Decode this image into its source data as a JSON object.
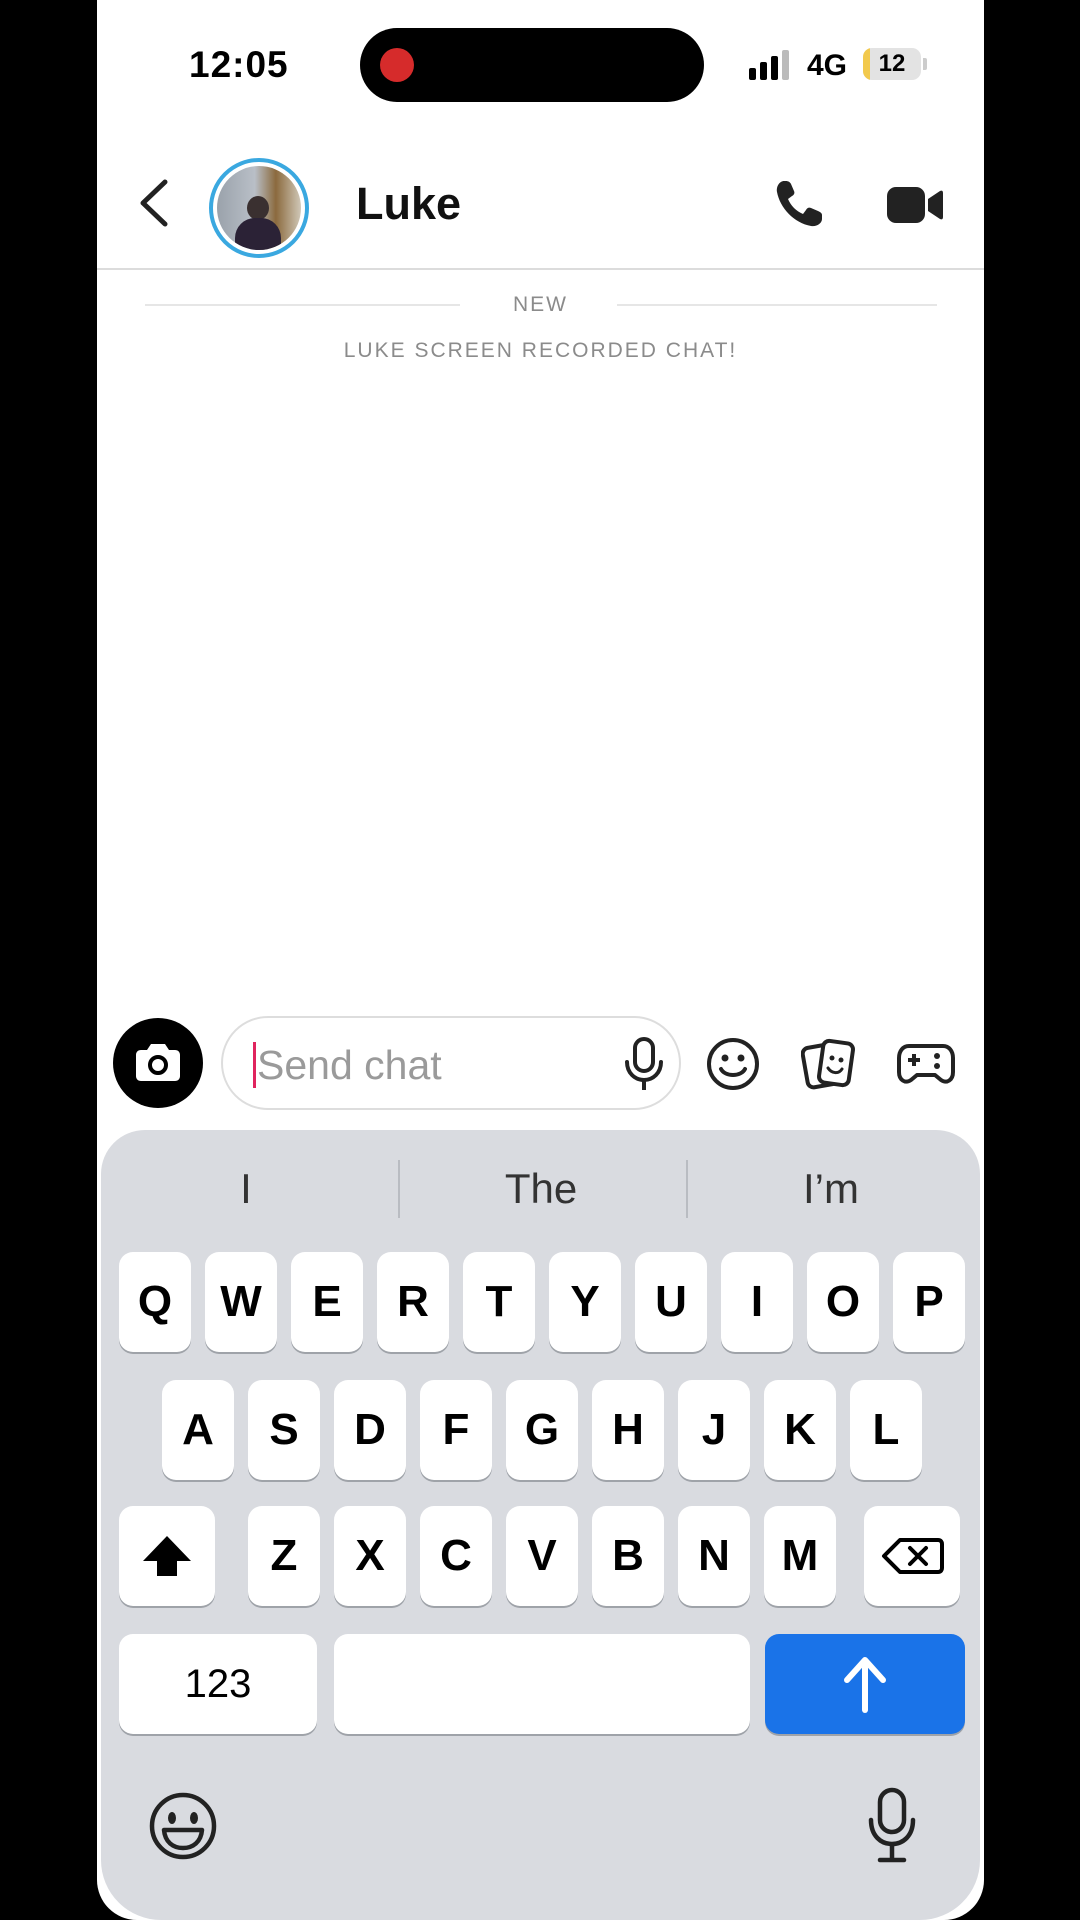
{
  "status_bar": {
    "time": "12:05",
    "network": "4G",
    "battery": "12",
    "battery_fraction": 0.12,
    "signal_bars_filled": 3,
    "signal_bars_total": 4
  },
  "header": {
    "contact_name": "Luke"
  },
  "messages": {
    "new_label": "NEW",
    "system_message": "LUKE SCREEN RECORDED CHAT!"
  },
  "composer": {
    "placeholder": "Send chat"
  },
  "keyboard": {
    "suggestions": [
      "I",
      "The",
      "I’m"
    ],
    "row1": [
      "Q",
      "W",
      "E",
      "R",
      "T",
      "Y",
      "U",
      "I",
      "O",
      "P"
    ],
    "row2": [
      "A",
      "S",
      "D",
      "F",
      "G",
      "H",
      "J",
      "K",
      "L"
    ],
    "row3": [
      "Z",
      "X",
      "C",
      "V",
      "B",
      "N",
      "M"
    ],
    "numbers_key": "123"
  },
  "colors": {
    "accent_blue": "#1a73e8",
    "avatar_ring": "#3aa8e0",
    "cursor": "#e0245e",
    "recording_dot": "#d62b2b"
  },
  "icons": {
    "back": "chevron-left-icon",
    "call": "phone-icon",
    "video": "video-camera-icon",
    "camera": "camera-icon",
    "mic": "microphone-icon",
    "emoji": "smiley-icon",
    "sticker": "sticker-icon",
    "games": "gamepad-icon",
    "shift": "shift-icon",
    "delete": "backspace-icon",
    "send": "arrow-up-icon"
  }
}
